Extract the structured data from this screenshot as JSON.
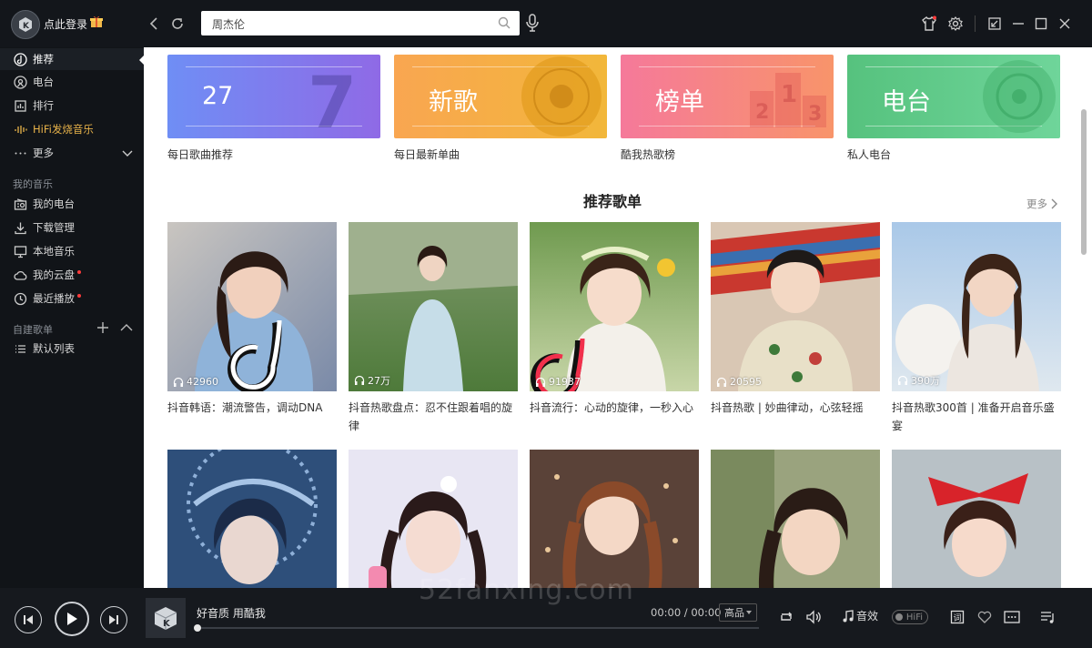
{
  "topbar": {
    "login_label": "点此登录",
    "search_value": "周杰伦"
  },
  "sidebar": {
    "items": [
      {
        "label": "推荐",
        "icon": "recommend-icon"
      },
      {
        "label": "电台",
        "icon": "radio-icon"
      },
      {
        "label": "排行",
        "icon": "chart-icon"
      },
      {
        "label": "HiFi发烧音乐",
        "icon": "hifi-icon"
      },
      {
        "label": "更多",
        "icon": "more-dots-icon"
      }
    ],
    "my_music_title": "我的音乐",
    "my_music": [
      {
        "label": "我的电台",
        "icon": "my-radio-icon"
      },
      {
        "label": "下载管理",
        "icon": "download-icon"
      },
      {
        "label": "本地音乐",
        "icon": "monitor-icon"
      },
      {
        "label": "我的云盘",
        "icon": "cloud-icon"
      },
      {
        "label": "最近播放",
        "icon": "clock-icon"
      }
    ],
    "playlist_title": "自建歌单",
    "playlists": [
      {
        "label": "默认列表",
        "icon": "list-icon"
      }
    ]
  },
  "banners": [
    {
      "title": "27",
      "caption": "每日歌曲推荐",
      "color_from": "#6f8ef5",
      "color_to": "#8f6ae6"
    },
    {
      "title": "新歌",
      "caption": "每日最新单曲",
      "color_from": "#f9a651",
      "color_to": "#f2b73a"
    },
    {
      "title": "榜单",
      "caption": "酷我热歌榜",
      "color_from": "#f5799a",
      "color_to": "#f8946a"
    },
    {
      "title": "电台",
      "caption": "私人电台",
      "color_from": "#56c27e",
      "color_to": "#6fd59a"
    }
  ],
  "section": {
    "title": "推荐歌单",
    "more_label": "更多"
  },
  "playlists_grid": [
    {
      "title": "抖音韩语：潮流警告，调动DNA",
      "plays": "42960"
    },
    {
      "title": "抖音热歌盘点：忍不住跟着唱的旋律",
      "plays": "27万"
    },
    {
      "title": "抖音流行：心动的旋律，一秒入心",
      "plays": "91937"
    },
    {
      "title": "抖音热歌 | 妙曲律动，心弦轻摇",
      "plays": "20595"
    },
    {
      "title": "抖音热歌300首 | 准备开启音乐盛宴",
      "plays": "390万"
    },
    {
      "title": "",
      "plays": ""
    },
    {
      "title": "",
      "plays": ""
    },
    {
      "title": "",
      "plays": ""
    },
    {
      "title": "",
      "plays": ""
    },
    {
      "title": "",
      "plays": ""
    }
  ],
  "player": {
    "song_title": "好音质 用酷我",
    "time": "00:00 / 00:00",
    "quality": "高品",
    "effects_label": "音效",
    "hifi_label": "HiFi",
    "progress": 0
  },
  "watermark": "52fanxing.com"
}
